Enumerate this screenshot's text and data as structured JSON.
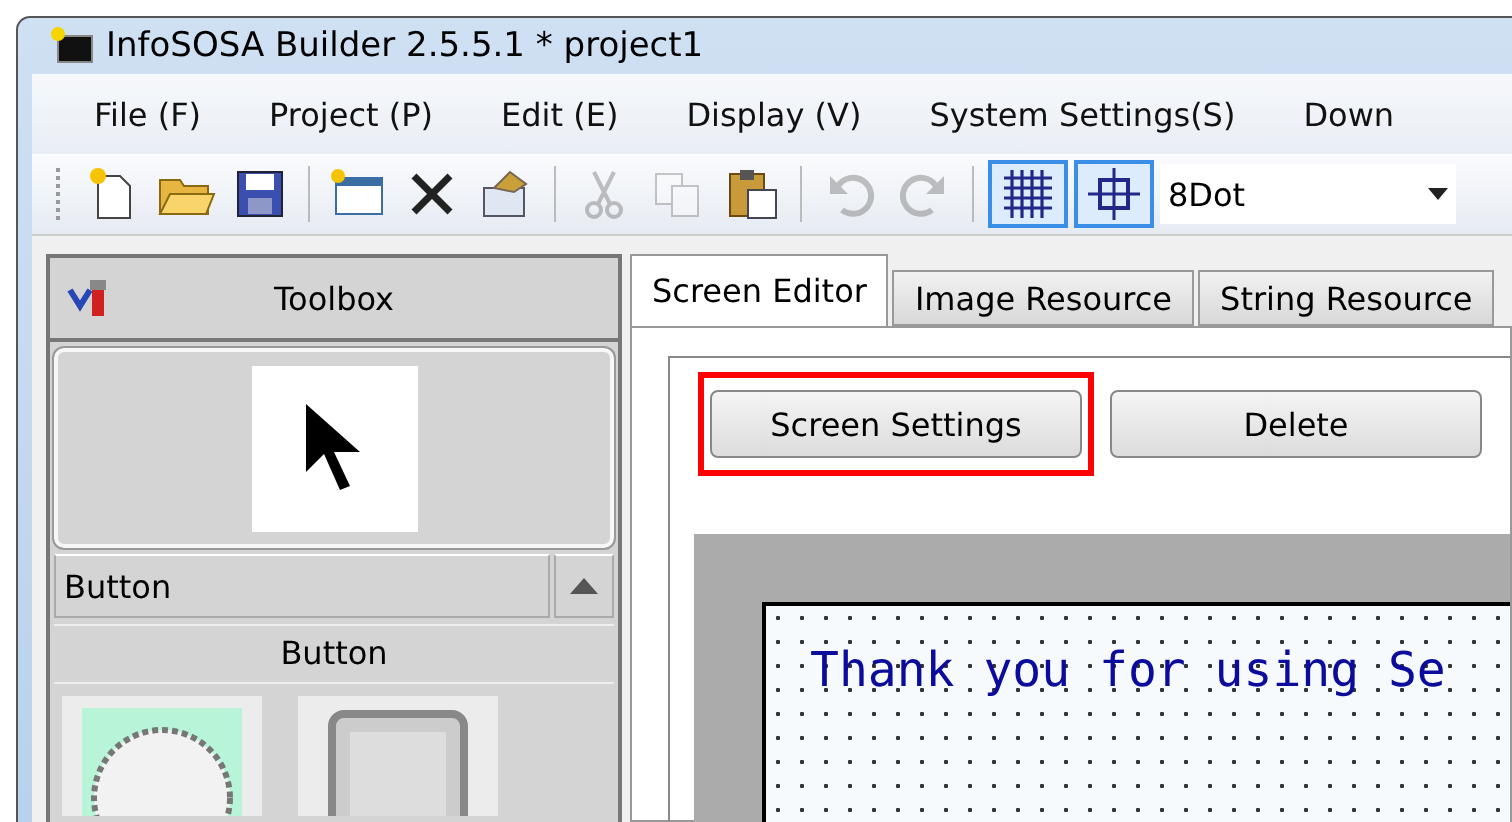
{
  "window": {
    "title": "InfoSOSA Builder 2.5.5.1 * project1"
  },
  "menu": [
    "File (F)",
    "Project (P)",
    "Edit (E)",
    "Display (V)",
    "System Settings(S)",
    "Down"
  ],
  "toolbar": [
    {
      "kind": "new",
      "disabled": false
    },
    {
      "kind": "open",
      "disabled": false
    },
    {
      "kind": "save",
      "disabled": false
    },
    {
      "kind": "sep"
    },
    {
      "kind": "screen",
      "disabled": false
    },
    {
      "kind": "delete",
      "disabled": false
    },
    {
      "kind": "properties",
      "disabled": false
    },
    {
      "kind": "sep"
    },
    {
      "kind": "cut",
      "disabled": true
    },
    {
      "kind": "copy",
      "disabled": true
    },
    {
      "kind": "paste",
      "disabled": false
    },
    {
      "kind": "sep"
    },
    {
      "kind": "undo",
      "disabled": true
    },
    {
      "kind": "redo",
      "disabled": true
    },
    {
      "kind": "sep"
    },
    {
      "kind": "grid",
      "selected": true
    },
    {
      "kind": "snap",
      "selected": true
    }
  ],
  "grid_select": {
    "value": "8Dot"
  },
  "toolbox": {
    "title": "Toolbox",
    "category": "Button",
    "group": "Button"
  },
  "tabs": [
    {
      "label": "Screen Editor",
      "selected": true
    },
    {
      "label": "Image Resource",
      "selected": false
    },
    {
      "label": "String Resource",
      "selected": false
    }
  ],
  "buttons": [
    {
      "label": "Screen Settings",
      "highlighted": true
    },
    {
      "label": "Delete",
      "highlighted": false
    }
  ],
  "canvas": {
    "text": "Thank you for using Se"
  }
}
